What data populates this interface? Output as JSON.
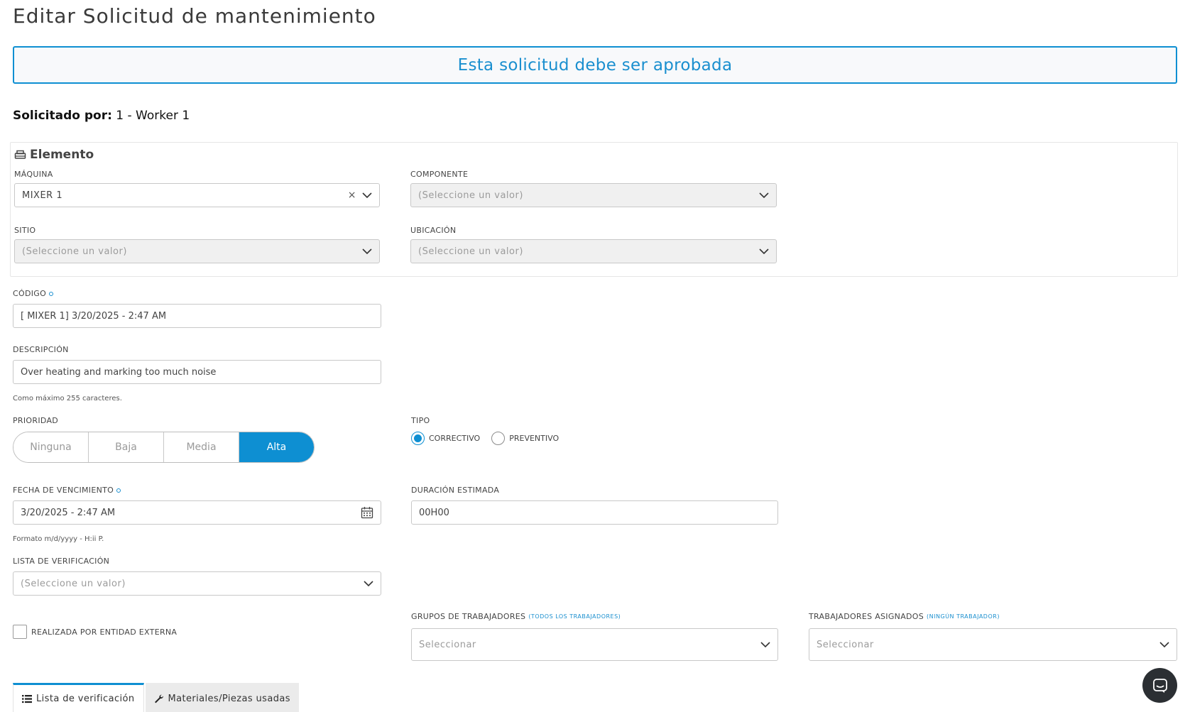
{
  "page": {
    "title": "Editar Solicitud de mantenimiento"
  },
  "banner": {
    "text": "Esta solicitud debe ser aprobada"
  },
  "requested_by": {
    "label": "Solicitado por:",
    "value": "1 - Worker 1"
  },
  "element_section": {
    "title": "Elemento",
    "machine": {
      "label": "Máquina",
      "value": "MIXER 1"
    },
    "component": {
      "label": "Componente",
      "placeholder": "(Seleccione un valor)"
    },
    "site": {
      "label": "Sitio",
      "placeholder": "(Seleccione un valor)"
    },
    "location": {
      "label": "Ubicación",
      "placeholder": "(Seleccione un valor)"
    }
  },
  "code": {
    "label": "Código",
    "value": "[ MIXER 1] 3/20/2025 - 2:47 AM"
  },
  "description": {
    "label": "Descripción",
    "value": "Over heating and marking too much noise",
    "help": "Como máximo 255 caracteres."
  },
  "priority": {
    "label": "Prioridad",
    "options": [
      "Ninguna",
      "Baja",
      "Media",
      "Alta"
    ],
    "selected": "Alta"
  },
  "type": {
    "label": "Tipo",
    "options": [
      "CORRECTIVO",
      "PREVENTIVO"
    ],
    "selected": "CORRECTIVO"
  },
  "due_date": {
    "label": "Fecha de vencimiento",
    "value": "3/20/2025 - 2:47 AM",
    "help": "Formato m/d/yyyy - H:ii P."
  },
  "duration": {
    "label": "Duración estimada",
    "value": "00H00"
  },
  "checklist": {
    "label": "Lista de verificación",
    "placeholder": "(Seleccione un valor)"
  },
  "external": {
    "label": "REALIZADA POR ENTIDAD EXTERNA",
    "checked": false
  },
  "worker_groups": {
    "label": "Grupos de trabajadores",
    "link": "(TODOS LOS TRABAJADORES)",
    "placeholder": "Seleccionar"
  },
  "assigned_workers": {
    "label": "Trabajadores asignados",
    "link": "(NINGÚN TRABAJADOR)",
    "placeholder": "Seleccionar"
  },
  "tabs": [
    {
      "label": "Lista de verificación",
      "icon": "list-icon",
      "active": true
    },
    {
      "label": "Materiales/Piezas usadas",
      "icon": "wrench-icon",
      "active": false
    }
  ],
  "colors": {
    "accent": "#0e8fd2",
    "chat": "#2b2f33"
  }
}
